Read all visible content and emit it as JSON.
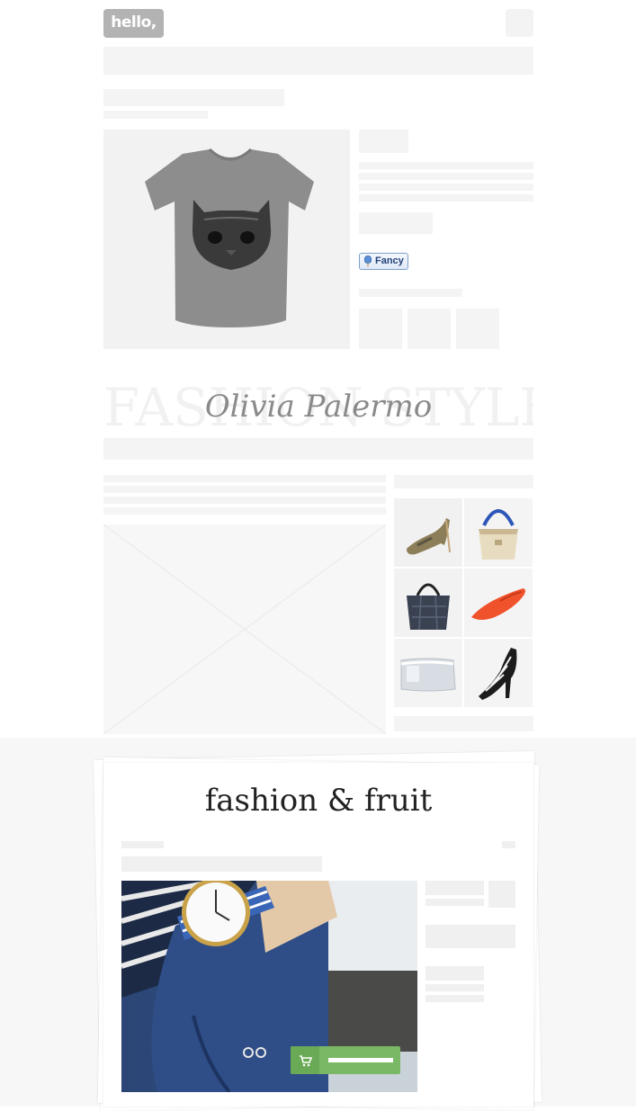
{
  "header": {
    "logo_text": "hello,"
  },
  "product": {
    "image_icon": "kitten-tshirt-image",
    "fancy_label": "Fancy"
  },
  "banner": {
    "background_text": "FASHION STYLE",
    "script_text": "Olivia Palermo"
  },
  "sidebar_grid": {
    "items": [
      {
        "icon": "camo-heel-shoe-image"
      },
      {
        "icon": "blue-handle-tote-image"
      },
      {
        "icon": "plaid-tote-image"
      },
      {
        "icon": "orange-flat-shoe-image"
      },
      {
        "icon": "silver-clutch-image"
      },
      {
        "icon": "black-strappy-sandal-image"
      }
    ]
  },
  "bottom": {
    "title": "fashion & fruit",
    "photo_icon": "watch-wrist-image",
    "cart_icon": "cart-icon"
  },
  "colors": {
    "accent_green": "#7ab865",
    "placeholder_gray": "#f4f4f4"
  }
}
